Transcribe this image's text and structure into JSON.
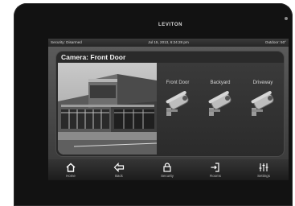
{
  "device": {
    "brand": "LEVITON"
  },
  "statusbar": {
    "security": "Security: Disarmed",
    "datetime": "Jul 15, 2013, 6:24:28 pm",
    "weather": "Outdoor: 50°"
  },
  "panel": {
    "title": "Camera: Front Door"
  },
  "cameras": [
    {
      "label": "Front Door",
      "icon": "security-camera-icon"
    },
    {
      "label": "Backyard",
      "icon": "security-camera-icon"
    },
    {
      "label": "Driveway",
      "icon": "security-camera-icon"
    }
  ],
  "nav": [
    {
      "label": "Home",
      "icon": "home-icon"
    },
    {
      "label": "Back",
      "icon": "back-arrow-icon"
    },
    {
      "label": "Security",
      "icon": "lock-icon"
    },
    {
      "label": "Rooms",
      "icon": "door-icon"
    },
    {
      "label": "Settings",
      "icon": "sliders-icon"
    }
  ]
}
